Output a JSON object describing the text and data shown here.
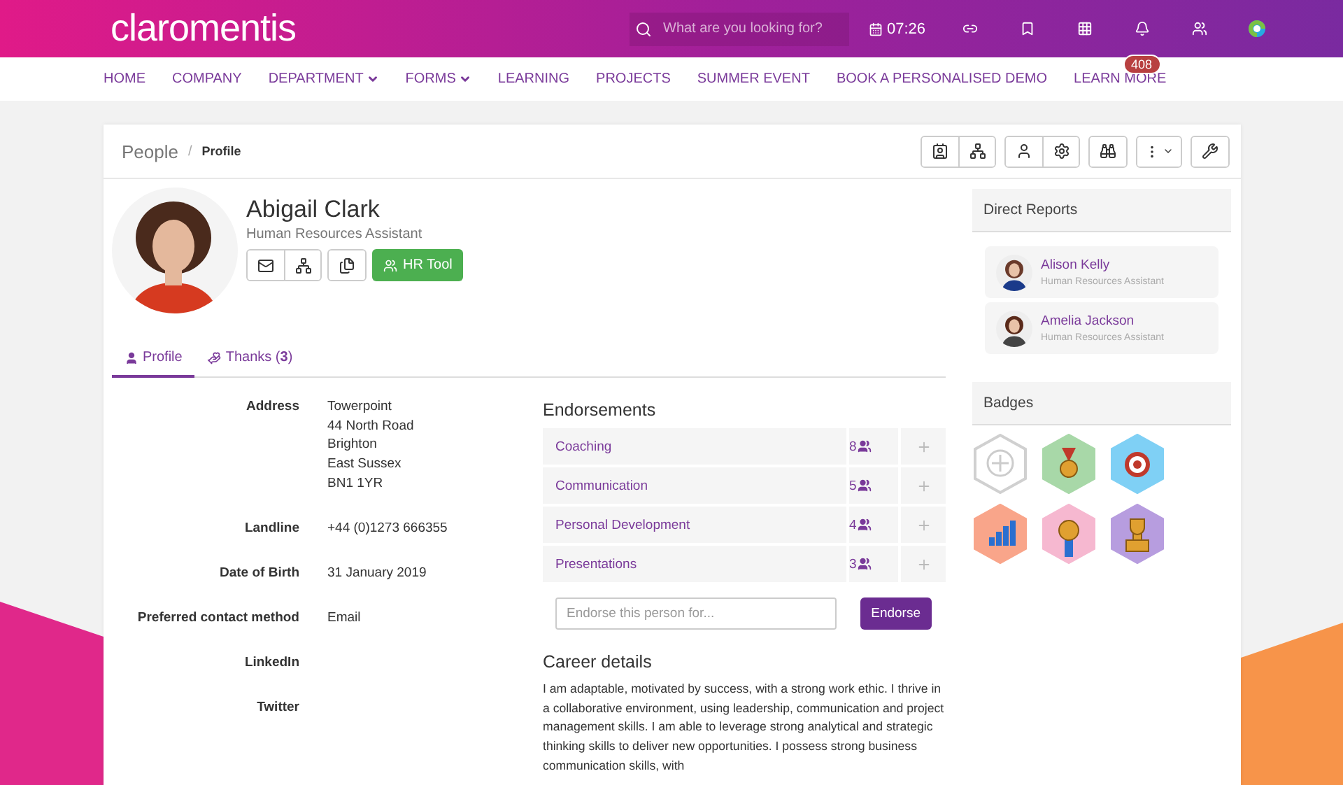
{
  "header": {
    "logo": "claromentis",
    "search": {
      "placeholder": "What are you looking for?"
    },
    "time": "07:26",
    "notification_count": "408"
  },
  "nav": [
    {
      "label": "HOME",
      "has_menu": false
    },
    {
      "label": "COMPANY",
      "has_menu": false
    },
    {
      "label": "DEPARTMENT",
      "has_menu": true
    },
    {
      "label": "FORMS",
      "has_menu": true
    },
    {
      "label": "LEARNING",
      "has_menu": false
    },
    {
      "label": "PROJECTS",
      "has_menu": false
    },
    {
      "label": "SUMMER EVENT",
      "has_menu": false
    },
    {
      "label": "BOOK A PERSONALISED DEMO",
      "has_menu": false
    },
    {
      "label": "LEARN MORE",
      "has_menu": false
    }
  ],
  "breadcrumb": {
    "parent": "People",
    "separator": "/",
    "current": "Profile"
  },
  "profile": {
    "name": "Abigail Clark",
    "role": "Human Resources Assistant",
    "hr_button": "HR Tool"
  },
  "tabs": [
    {
      "label": "Profile",
      "selected": true
    },
    {
      "label": "Thanks (**3**)",
      "selected": false
    }
  ],
  "details": [
    {
      "label": "Address",
      "lines": [
        "Towerpoint",
        "44 North Road",
        "Brighton",
        "East Sussex",
        "BN1 1YR"
      ]
    },
    {
      "label": "Landline",
      "lines": [
        "+44 (0)1273 666355"
      ]
    },
    {
      "label": "Date of Birth",
      "lines": [
        "31 January 2019"
      ]
    },
    {
      "label": "Preferred contact method",
      "lines": [
        "Email"
      ]
    },
    {
      "label": "LinkedIn"
    },
    {
      "label": "Twitter"
    }
  ],
  "endorsements": {
    "title": "Endorsements",
    "items": [
      {
        "name": "Coaching",
        "count": "8"
      },
      {
        "name": "Communication",
        "count": "5"
      },
      {
        "name": "Personal Development",
        "count": "4"
      },
      {
        "name": "Presentations",
        "count": "3"
      }
    ],
    "placeholder": "Endorse this person for...",
    "button": "Endorse"
  },
  "career": {
    "title": "Career details",
    "text": "I am adaptable, motivated by success, with a strong work ethic. I thrive in a collaborative environment, using leadership, communication and project management skills. I am able to leverage strong analytical and strategic thinking skills to deliver new opportunities. I possess strong business communication skills, with"
  },
  "direct_reports": {
    "title": "Direct Reports",
    "people": [
      {
        "name": "Alison Kelly",
        "role": "Human Resources Assistant"
      },
      {
        "name": "Amelia Jackson",
        "role": "Human Resources Assistant"
      }
    ]
  },
  "badges": {
    "title": "Badges",
    "items": [
      {
        "kind": "add",
        "color": "#d0d0d0"
      },
      {
        "kind": "medal",
        "color": "#a8d8a8"
      },
      {
        "kind": "target",
        "color": "#7fd0f5"
      },
      {
        "kind": "chart",
        "color": "#f9a58a"
      },
      {
        "kind": "rosette",
        "color": "#f6b8d0"
      },
      {
        "kind": "trophy",
        "color": "#b79ddf"
      }
    ]
  }
}
